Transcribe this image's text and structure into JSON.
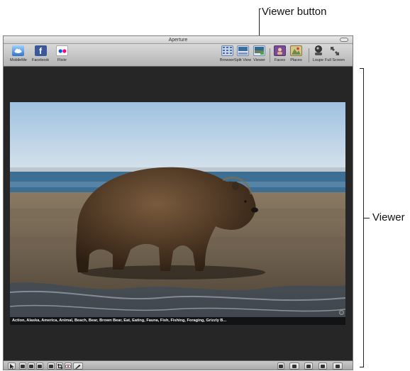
{
  "callouts": {
    "viewer_button": "Viewer button",
    "viewer": "Viewer"
  },
  "window": {
    "title": "Aperture"
  },
  "toolbar": {
    "share_items": [
      {
        "label": "MobileMe",
        "icon": "mobileme-icon"
      },
      {
        "label": "Facebook",
        "icon": "facebook-icon"
      },
      {
        "label": "Flickr",
        "icon": "flickr-icon"
      }
    ],
    "view_items": [
      {
        "label": "Browser",
        "icon": "browser-icon"
      },
      {
        "label": "Split View",
        "icon": "split-view-icon"
      },
      {
        "label": "Viewer",
        "icon": "viewer-icon"
      }
    ],
    "people_items": [
      {
        "label": "Faces",
        "icon": "faces-icon"
      },
      {
        "label": "Places",
        "icon": "places-icon"
      }
    ],
    "tool_items": [
      {
        "label": "Loupe",
        "icon": "loupe-icon"
      },
      {
        "label": "Full Screen",
        "icon": "full-screen-icon"
      }
    ]
  },
  "viewer": {
    "keywords": "Action, Alaska, America, Animal, Beach, Bear, Brown Bear, Eat, Eating, Fauna, Fish, Fishing, Foraging, Grizzly B..."
  },
  "colors": {
    "viewer_bg": "#262626",
    "facebook_blue": "#3b5998",
    "flickr_pink": "#ff0084",
    "flickr_blue": "#0063dc"
  }
}
